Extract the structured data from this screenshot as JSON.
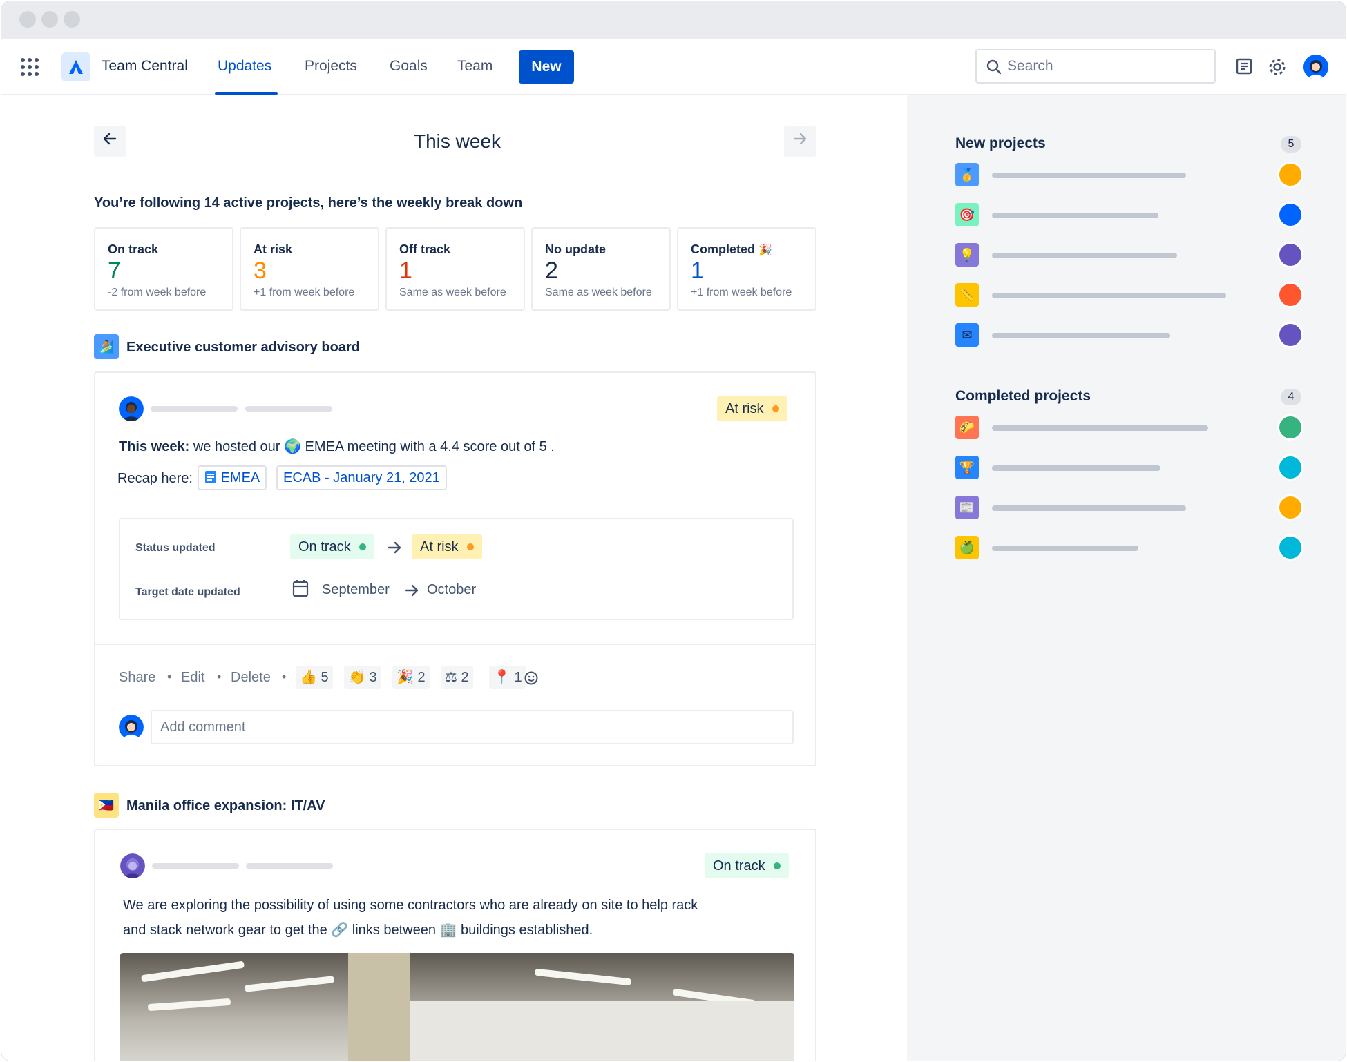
{
  "navbar": {
    "app_title": "Team Central",
    "links": [
      "Updates",
      "Projects",
      "Goals",
      "Team"
    ],
    "active": "Updates",
    "new_label": "New",
    "search_placeholder": "Search",
    "icons": [
      "app-switcher-icon",
      "atlassian-logo-icon",
      "search-icon",
      "feedback-icon",
      "settings-icon",
      "user-avatar"
    ]
  },
  "week": {
    "title": "This week",
    "intro": "You’re following 14 active projects, here’s the weekly break down"
  },
  "stats": [
    {
      "label": "On track",
      "value": "7",
      "sub": "-2 from week before",
      "color": "#00875A"
    },
    {
      "label": "At risk",
      "value": "3",
      "sub": "+1 from week before",
      "color": "#FF8B00"
    },
    {
      "label": "Off track",
      "value": "1",
      "sub": "Same as week before",
      "color": "#DE350B"
    },
    {
      "label": "No update",
      "value": "2",
      "sub": "Same as week before",
      "color": "#172B4D"
    },
    {
      "label": "Completed",
      "value": "1",
      "sub": "+1 from week before",
      "color": "#0052CC",
      "emoji": "🎉"
    }
  ],
  "update1": {
    "project_title": "Executive customer advisory board",
    "status": "At risk",
    "text_bold": "This week:",
    "text_a": "we hosted our",
    "text_b": "EMEA meeting with a 4.4 score out of 5 .",
    "recap_label": "Recap here:",
    "link1": "EMEA",
    "link2": "ECAB - January 21, 2021",
    "status_updated_label": "Status updated",
    "status_from": "On track",
    "status_to": "At risk",
    "target_label": "Target date updated",
    "date_from": "September",
    "date_to": "October",
    "actions": [
      "Share",
      "Edit",
      "Delete"
    ],
    "reactions": [
      {
        "emoji": "👍",
        "count": "5"
      },
      {
        "emoji": "👏",
        "count": "3"
      },
      {
        "emoji": "🎉",
        "count": "2"
      },
      {
        "emoji": "⚖",
        "count": "2"
      },
      {
        "emoji": "📍",
        "count": "1"
      }
    ],
    "comment_placeholder": "Add comment"
  },
  "update2": {
    "project_title": "Manila office expansion: IT/AV",
    "status": "On track",
    "line1": "We are exploring the possibility of using some contractors who are already on site to help rack",
    "line2_a": "and stack network gear to get the",
    "line2_b": "links between",
    "line2_c": "buildings established."
  },
  "sidebar": {
    "new_title": "New projects",
    "new_count": "5",
    "completed_title": "Completed projects",
    "completed_count": "4"
  },
  "colors": {
    "brand": "#0052CC",
    "at_risk_bg": "#FFF0B3",
    "on_track_bg": "#E3FCEF",
    "sidebar_bg": "#F4F5F7"
  }
}
